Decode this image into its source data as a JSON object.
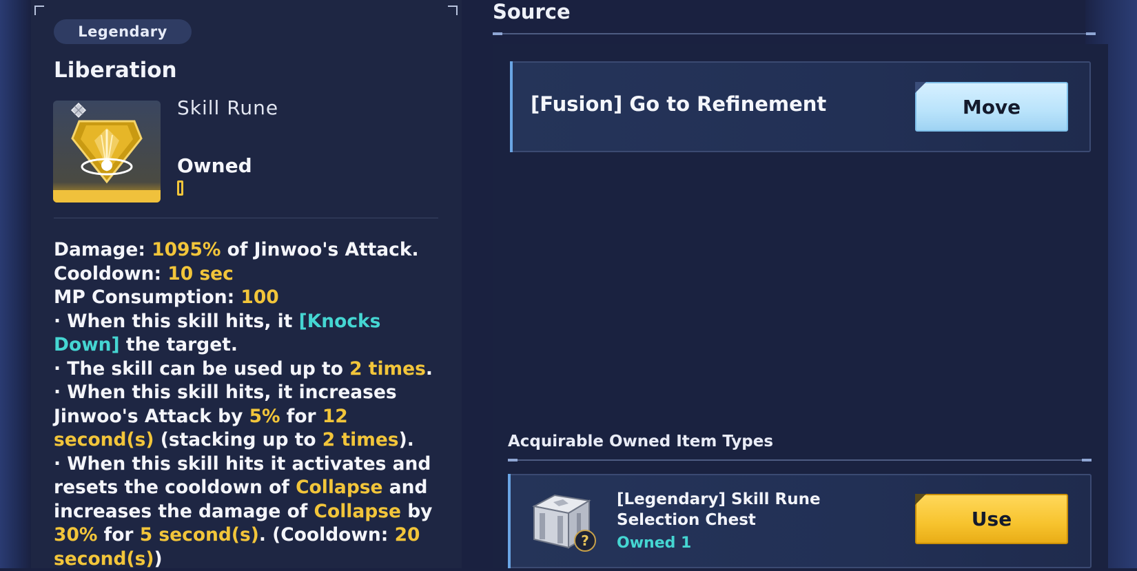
{
  "item": {
    "rarity": "Legendary",
    "name": "Liberation",
    "type": "Skill Rune",
    "owned_label": "Owned",
    "owned_value": "",
    "icon": "gold-shield-rune-icon"
  },
  "description": {
    "damage_label": "Damage: ",
    "damage_value": "1095%",
    "damage_suffix": " of Jinwoo's Attack.",
    "cooldown_label": "Cooldown: ",
    "cooldown_value": "10 sec",
    "mp_label": "MP Consumption: ",
    "mp_value": "100",
    "line1_a": "· When this skill hits, it ",
    "line1_kw": "[Knocks Down]",
    "line1_b": " the target.",
    "line2_a": "· The skill can be used up to ",
    "line2_val": "2 times",
    "line2_b": ".",
    "line3_a": "· When this skill hits, it increases Jinwoo's Attack by ",
    "line3_pct": "5%",
    "line3_b": " for ",
    "line3_dur": "12 second(s)",
    "line3_c": " (stacking up to ",
    "line3_stack": "2 times",
    "line3_d": ").",
    "line4_a": "· When this skill hits it activates and resets the cooldown of ",
    "line4_skill1": "Collapse",
    "line4_b": " and increases the damage of ",
    "line4_skill2": "Collapse",
    "line4_c": " by ",
    "line4_pct": "30%",
    "line4_d": " for ",
    "line4_dur": "5 second(s)",
    "line4_e": ". (Cooldown: ",
    "line4_cd": "20 second(s)",
    "line4_f": ")"
  },
  "source": {
    "title": "Source",
    "entry_label": "[Fusion] Go to Refinement",
    "move_button": "Move"
  },
  "acquirable": {
    "title": "Acquirable Owned Item Types",
    "chest_name": "[Legendary] Skill Rune Selection Chest",
    "chest_owned": "Owned 1",
    "use_button": "Use",
    "icon": "white-chest-icon"
  },
  "colors": {
    "highlight_yellow": "#f2c53a",
    "highlight_cyan": "#45d6d2",
    "move_button": "#b9e3fb",
    "use_button": "#f7c32e"
  }
}
